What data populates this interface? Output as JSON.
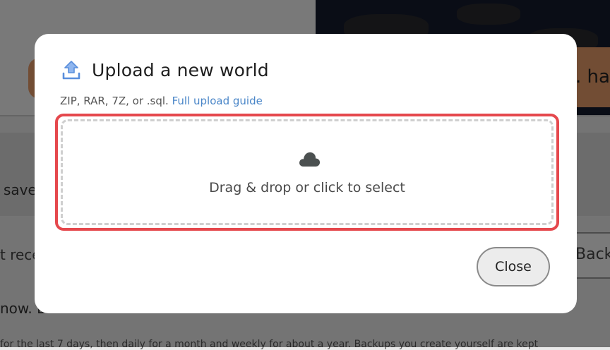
{
  "background": {
    "top_right_text": ". hap",
    "band_text": "save",
    "row_text": "t rece",
    "back_button_label": "Back",
    "line3": "now. B",
    "line4": "for the last 7 days, then daily for a month and weekly for about a year. Backups you create yourself are kept"
  },
  "modal": {
    "title": "Upload a new world",
    "subtitle_prefix": "ZIP, RAR, 7Z, or .sql.",
    "guide_link": "Full upload guide",
    "dropzone_text": "Drag & drop or click to select",
    "close_label": "Close"
  },
  "icons": {
    "upload": "upload-arrow-icon",
    "cloud": "cloud-icon"
  },
  "colors": {
    "accent_blue": "#4a86c8",
    "highlight_red": "#e5484d",
    "upload_icon_blue": "#6a9be0"
  }
}
